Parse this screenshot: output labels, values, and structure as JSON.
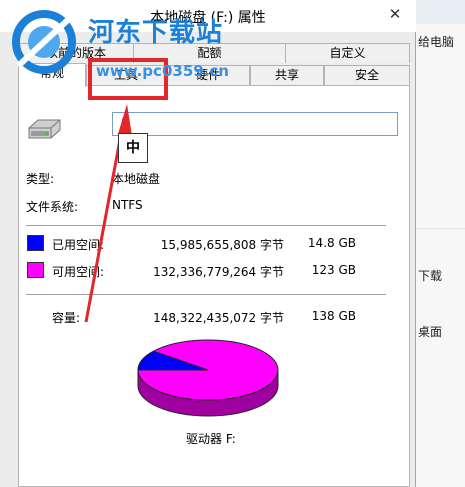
{
  "window": {
    "title": "本地磁盘 (F:) 属性",
    "close_symbol": "✕"
  },
  "tabs_row1": [
    "以前的版本",
    "配额",
    "自定义"
  ],
  "tabs_row2": [
    "常规",
    "工具",
    "硬件",
    "共享",
    "安全"
  ],
  "general": {
    "name_value": "",
    "ime_indicator": "中",
    "type_label": "类型:",
    "type_value": "本地磁盘",
    "fs_label": "文件系统:",
    "fs_value": "NTFS",
    "used": {
      "label": "已用空间:",
      "bytes": "15,985,655,808 字节",
      "size": "14.8 GB",
      "color": "#0000ff"
    },
    "free": {
      "label": "可用空间:",
      "bytes": "132,336,779,264 字节",
      "size": "123 GB",
      "color": "#ff00ff"
    },
    "capacity": {
      "label": "容量:",
      "bytes": "148,322,435,072 字节",
      "size": "138 GB"
    },
    "drive_label": "驱动器 F:",
    "used_fraction": 0.108
  },
  "background": {
    "items": [
      "给电脑",
      "下载",
      "桌面"
    ]
  },
  "watermark": {
    "title": "河东下载站",
    "url": "www.pc0359.cn"
  },
  "annotation": {
    "color": "#e2262c"
  }
}
